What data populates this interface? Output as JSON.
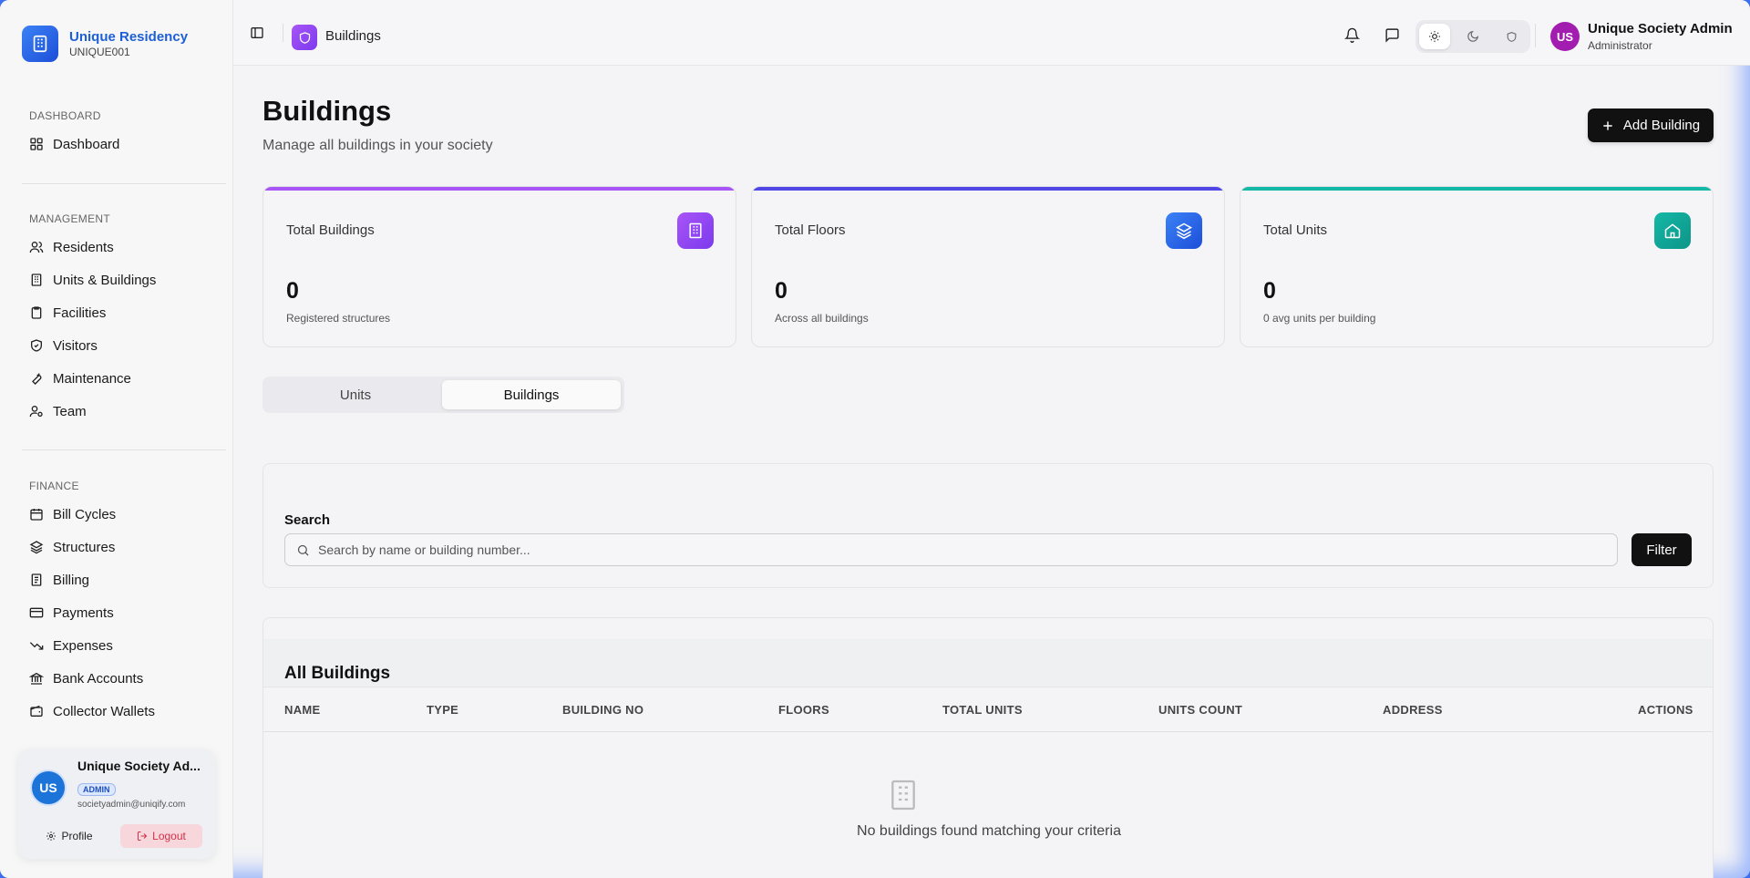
{
  "brand": {
    "name": "Unique Residency",
    "code": "UNIQUE001"
  },
  "sidebar": {
    "sections": [
      {
        "heading": "DASHBOARD",
        "items": [
          {
            "label": "Dashboard",
            "icon": "grid-icon"
          }
        ]
      },
      {
        "heading": "MANAGEMENT",
        "items": [
          {
            "label": "Residents",
            "icon": "users-icon"
          },
          {
            "label": "Units & Buildings",
            "icon": "building-icon"
          },
          {
            "label": "Facilities",
            "icon": "clipboard-icon"
          },
          {
            "label": "Visitors",
            "icon": "shield-icon"
          },
          {
            "label": "Maintenance",
            "icon": "wrench-icon"
          },
          {
            "label": "Team",
            "icon": "user-cog-icon"
          }
        ]
      },
      {
        "heading": "FINANCE",
        "items": [
          {
            "label": "Bill Cycles",
            "icon": "calendar-icon"
          },
          {
            "label": "Structures",
            "icon": "layers-icon"
          },
          {
            "label": "Billing",
            "icon": "receipt-icon"
          },
          {
            "label": "Payments",
            "icon": "credit-card-icon"
          },
          {
            "label": "Expenses",
            "icon": "trending-down-icon"
          },
          {
            "label": "Bank Accounts",
            "icon": "bank-icon"
          },
          {
            "label": "Collector Wallets",
            "icon": "wallet-icon"
          }
        ]
      }
    ]
  },
  "user_card": {
    "initials": "US",
    "name": "Unique Society Ad...",
    "badge": "ADMIN",
    "email": "societyadmin@uniqify.com",
    "profile_label": "Profile",
    "logout_label": "Logout"
  },
  "topbar": {
    "breadcrumb": "Buildings",
    "user_initials": "US",
    "user_name": "Unique Society Admin",
    "user_role": "Administrator"
  },
  "page": {
    "title": "Buildings",
    "subtitle": "Manage all buildings in your society",
    "add_button": "Add Building"
  },
  "stats": [
    {
      "label": "Total Buildings",
      "value": "0",
      "note": "Registered structures",
      "color": "#a855f7"
    },
    {
      "label": "Total Floors",
      "value": "0",
      "note": "Across all buildings",
      "color": "#4f46e5"
    },
    {
      "label": "Total Units",
      "value": "0",
      "note": "0 avg units per building",
      "color": "#14b8a6"
    }
  ],
  "tabs": [
    "Units",
    "Buildings"
  ],
  "search": {
    "label": "Search",
    "placeholder": "Search by name or building number...",
    "filter_label": "Filter"
  },
  "table": {
    "title": "All Buildings",
    "columns": [
      "NAME",
      "TYPE",
      "BUILDING NO",
      "FLOORS",
      "TOTAL UNITS",
      "UNITS COUNT",
      "ADDRESS",
      "ACTIONS"
    ],
    "empty_message": "No buildings found matching your criteria"
  }
}
